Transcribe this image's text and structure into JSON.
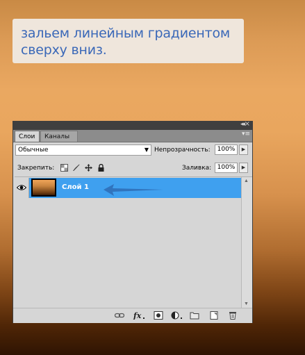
{
  "caption": {
    "line1": "зальем линейным градиентом",
    "line2": "сверху вниз."
  },
  "panel": {
    "tabs": [
      {
        "label": "Слои",
        "active": true
      },
      {
        "label": "Каналы",
        "active": false
      }
    ],
    "blend_mode": "Обычные",
    "opacity_label": "Непрозрачность:",
    "opacity_value": "100%",
    "lock_label": "Закрепить:",
    "fill_label": "Заливка:",
    "fill_value": "100%",
    "layers": [
      {
        "name": "Слой 1",
        "visible": true,
        "selected": true
      }
    ],
    "footer_icons": [
      "link-layers-icon",
      "fx-icon",
      "add-mask-icon",
      "adjustment-layer-icon",
      "new-group-icon",
      "new-layer-icon",
      "trash-icon"
    ]
  },
  "colors": {
    "selection": "#3fa0ef",
    "caption_text": "#3a68b8",
    "arrow": "#2f6fb8"
  }
}
